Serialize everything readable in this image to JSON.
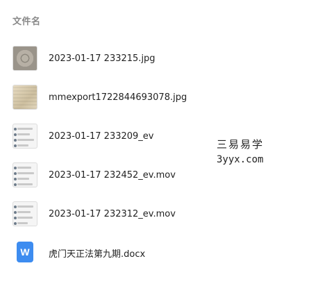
{
  "header": {
    "title": "文件名"
  },
  "files": [
    {
      "name": "2023-01-17 233215.jpg",
      "icon": "image-thumbnail-icon"
    },
    {
      "name": "mmexport1722844693078.jpg",
      "icon": "image-thumbnail-icon"
    },
    {
      "name": "2023-01-17 233209_ev",
      "icon": "video-thumbnail-icon"
    },
    {
      "name": "2023-01-17 232452_ev.mov",
      "icon": "video-thumbnail-icon"
    },
    {
      "name": "2023-01-17 232312_ev.mov",
      "icon": "video-thumbnail-icon"
    },
    {
      "name": "虎门天正法第九期.docx",
      "icon": "word-doc-icon"
    }
  ],
  "doc_icon_letter": "W",
  "watermark": {
    "line1": "三易易学",
    "line2": "3yyx.com"
  },
  "colors": {
    "header": "#888888",
    "text": "#222222",
    "doc_accent": "#3d8cf0"
  }
}
